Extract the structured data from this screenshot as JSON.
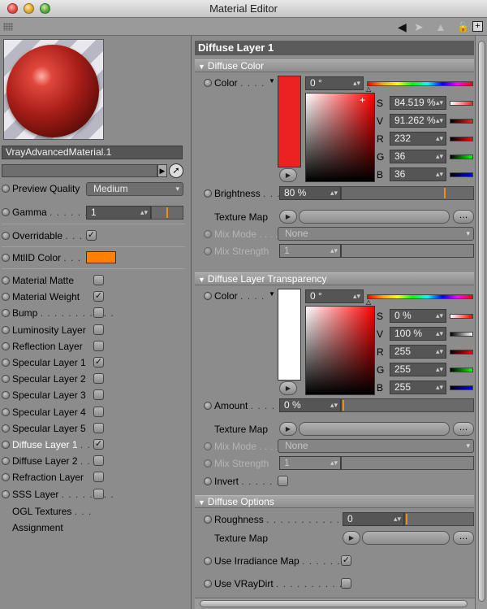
{
  "window": {
    "title": "Material Editor"
  },
  "left": {
    "material_name": "VrayAdvancedMaterial.1",
    "preview_quality": {
      "label": "Preview Quality",
      "value": "Medium"
    },
    "gamma": {
      "label": "Gamma",
      "dots": ". . . . . . .",
      "value": "1"
    },
    "overridable": {
      "label": "Overridable",
      "dots": ". . .",
      "checked": "✓"
    },
    "mtlid_color": {
      "label": "MtlID Color",
      "dots": ". . .",
      "color": "#ff8000"
    },
    "channels": [
      {
        "label": "Material Matte",
        "dots": "",
        "checked": ""
      },
      {
        "label": "Material Weight",
        "dots": "",
        "checked": "✓"
      },
      {
        "label": "Bump",
        "dots": ". . . . . . . . . . .",
        "checked": ""
      },
      {
        "label": "Luminosity Layer",
        "dots": "",
        "checked": ""
      },
      {
        "label": "Reflection Layer",
        "dots": "",
        "checked": ""
      },
      {
        "label": "Specular Layer 1",
        "dots": "",
        "checked": "✓"
      },
      {
        "label": "Specular Layer 2",
        "dots": "",
        "checked": ""
      },
      {
        "label": "Specular Layer 3",
        "dots": "",
        "checked": ""
      },
      {
        "label": "Specular Layer 4",
        "dots": "",
        "checked": ""
      },
      {
        "label": "Specular Layer 5",
        "dots": "",
        "checked": ""
      },
      {
        "label": "Diffuse Layer 1",
        "dots": ". .",
        "checked": "✓"
      },
      {
        "label": "Diffuse Layer 2",
        "dots": ". .",
        "checked": ""
      },
      {
        "label": "Refraction Layer",
        "dots": "",
        "checked": ""
      },
      {
        "label": "SSS Layer",
        "dots": ". . . . . . . .",
        "checked": ""
      }
    ],
    "ogl_textures": {
      "label": "OGL Textures",
      "dots": ". . ."
    },
    "assignment": {
      "label": "Assignment"
    }
  },
  "right": {
    "panel_title": "Diffuse Layer 1",
    "diffuse_color": {
      "group": "Diffuse Color",
      "color_label": "Color",
      "color_dots": ". . . .",
      "swatch": "#ec2121",
      "hue": "0 °",
      "S_label": "S",
      "S": "84.519 %",
      "V_label": "V",
      "V": "91.262 %",
      "R_label": "R",
      "R": "232",
      "G_label": "G",
      "G": "36",
      "B_label": "B",
      "B": "36",
      "brightness_label": "Brightness",
      "brightness_dots": ". . .",
      "brightness": "80 %",
      "brightness_level": 0.8,
      "texture_map": "Texture Map",
      "mix_mode_label": "Mix Mode",
      "mix_mode_dots": ". . . .",
      "mix_mode": "None",
      "mix_strength_label": "Mix Strength",
      "mix_strength": "1"
    },
    "transparency": {
      "group": "Diffuse Layer Transparency",
      "color_label": "Color",
      "color_dots": ". . . .",
      "swatch": "#ffffff",
      "hue": "0 °",
      "S_label": "S",
      "S": "0 %",
      "V_label": "V",
      "V": "100 %",
      "R_label": "R",
      "R": "255",
      "G_label": "G",
      "G": "255",
      "B_label": "B",
      "B": "255",
      "amount_label": "Amount",
      "amount_dots": ". . . .",
      "amount": "0 %",
      "texture_map": "Texture Map",
      "mix_mode_label": "Mix Mode",
      "mix_mode_dots": ". . . .",
      "mix_mode": "None",
      "mix_strength_label": "Mix Strength",
      "mix_strength": "1",
      "invert_label": "Invert",
      "invert_dots": ". . . . . . ."
    },
    "options": {
      "group": "Diffuse Options",
      "roughness_label": "Roughness",
      "roughness_dots": ". . . . . . . . . . . . . .",
      "roughness": "0",
      "texture_map": "Texture Map",
      "irradiance_label": "Use Irradiance Map",
      "irradiance_dots": ". . . . . .",
      "irradiance_checked": "✓",
      "vraydirt_label": "Use VRayDirt",
      "vraydirt_dots": ". . . . . . . . . . ."
    }
  }
}
